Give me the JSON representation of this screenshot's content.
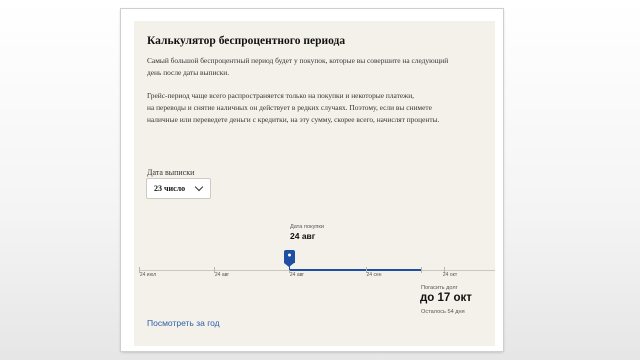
{
  "calculator": {
    "title": "Калькулятор беспроцентного периода",
    "paragraph1": [
      "Самый большой беспроцентный период будет у покупок, которые вы совершите на следующий",
      "день после даты выписки."
    ],
    "paragraph2": [
      "Грейс-период чаще всего распространяется только на покупки и некоторые платежи,",
      "на переводы и снятие наличных он действует в редких случаях. Поэтому, если вы снимете",
      "наличные или переведете деньги с кредитки, на эту сумму, скорее всего, начислят проценты."
    ],
    "statement_date_label": "Дата выписки",
    "statement_date_value": "23 число",
    "timeline": {
      "purchase_label": "Дата покупки",
      "purchase_date": "24 авг",
      "ticks": [
        "24 июл",
        "24 авг",
        "24 авг",
        "24 сен",
        "24 окт"
      ],
      "repay_label": "Погасить долг",
      "repay_date": "до 17 окт",
      "remaining": "Осталось 54 дня"
    },
    "view_year_link": "Посмотреть за год"
  },
  "colors": {
    "card_background": "#f4f1ea",
    "accent": "#1f4fa3",
    "link": "#2c5fa8"
  }
}
